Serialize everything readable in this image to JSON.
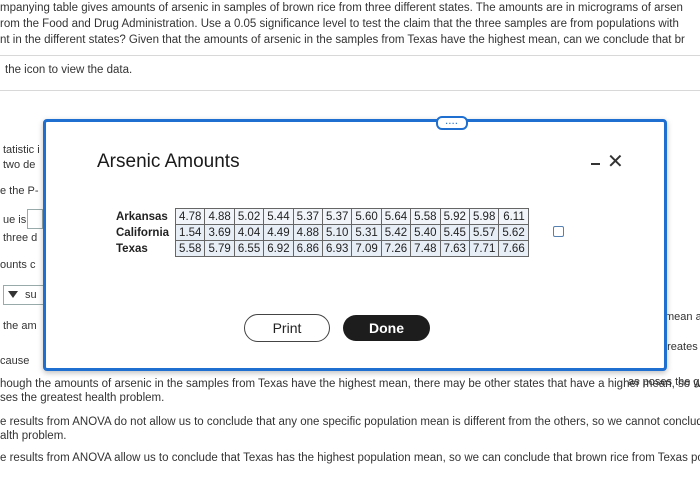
{
  "background": {
    "lines": [
      "mpanying table gives amounts of arsenic in samples of brown rice from three different states. The amounts are in micrograms of arsen",
      "rom the Food and Drug Administration. Use a 0.05 significance level to test the claim that the three samples are from populations with",
      "nt in the different states? Given that the amounts of arsenic in the samples from Texas have the highest mean, can we conclude that br"
    ],
    "view_data_text": "the icon to view the data.",
    "left_fragments": [
      "tatistic i",
      "two de",
      "e the P-",
      "ue is",
      "three d",
      "ounts c",
      "su",
      "the am",
      "cause"
    ],
    "right_fragments": [
      "mean a",
      "es the greates",
      "as poses the g"
    ],
    "answer_lines": [
      "hough the amounts of arsenic in the samples from Texas have the highest mean, there may be other states that have a higher mean, so w",
      "ses the greatest health problem.",
      "e results from ANOVA do not allow us to conclude that any one specific population mean is different from the others, so we cannot conclud",
      "alth problem.",
      "e results from ANOVA allow us to conclude that Texas has the highest population mean, so we can conclude that brown rice from Texas pos"
    ]
  },
  "modal": {
    "handle_label": "....",
    "title": "Arsenic Amounts",
    "minimize_label": "-",
    "close_label": "✕",
    "table": [
      {
        "state": "Arkansas",
        "values": [
          "4.78",
          "4.88",
          "5.02",
          "5.44",
          "5.37",
          "5.37",
          "5.60",
          "5.64",
          "5.58",
          "5.92",
          "5.98",
          "6.11"
        ]
      },
      {
        "state": "California",
        "values": [
          "1.54",
          "3.69",
          "4.04",
          "4.49",
          "4.88",
          "5.10",
          "5.31",
          "5.42",
          "5.40",
          "5.45",
          "5.57",
          "5.62"
        ]
      },
      {
        "state": "Texas",
        "values": [
          "5.58",
          "5.79",
          "6.55",
          "6.92",
          "6.86",
          "6.93",
          "7.09",
          "7.26",
          "7.48",
          "7.63",
          "7.71",
          "7.66"
        ]
      }
    ],
    "print_label": "Print",
    "done_label": "Done"
  },
  "colors": {
    "accent": "#1f6fd1",
    "done_bg": "#1d1d1d"
  }
}
